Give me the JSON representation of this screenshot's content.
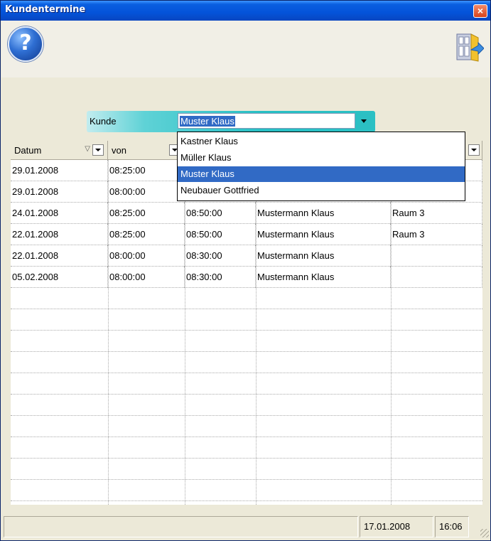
{
  "window": {
    "title": "Kundentermine",
    "close_label": "×"
  },
  "toolbar": {
    "help_label": "?",
    "help_icon": "help-icon",
    "exit_icon": "exit-door-icon"
  },
  "filter": {
    "label": "Kunde",
    "value": "Muster Klaus",
    "options": [
      "Kastner  Klaus",
      "Müller Klaus",
      "Muster Klaus",
      "Neubauer Gottfried"
    ],
    "selected_index": 2
  },
  "grid": {
    "columns": [
      {
        "label": "Datum",
        "sortable": true
      },
      {
        "label": "von",
        "sortable": false
      },
      {
        "label": "",
        "sortable": false
      },
      {
        "label": "",
        "sortable": false
      },
      {
        "label": "",
        "sortable": false
      }
    ],
    "sort_glyph": "▽",
    "rows": [
      [
        "29.01.2008",
        "08:25:00",
        "",
        "",
        ""
      ],
      [
        "29.01.2008",
        "08:00:00",
        "",
        "",
        ""
      ],
      [
        "24.01.2008",
        "08:25:00",
        "08:50:00",
        "Mustermann Klaus",
        "Raum 3"
      ],
      [
        "22.01.2008",
        "08:25:00",
        "08:50:00",
        "Mustermann Klaus",
        "Raum 3"
      ],
      [
        "22.01.2008",
        "08:00:00",
        "08:30:00",
        "Mustermann Klaus",
        ""
      ],
      [
        "05.02.2008",
        "08:00:00",
        "08:30:00",
        "Mustermann Klaus",
        ""
      ]
    ]
  },
  "statusbar": {
    "message": "",
    "date": "17.01.2008",
    "time": "16:06"
  },
  "colors": {
    "titlebar": "#0453d9",
    "filter_accent": "#28bfc4",
    "selection": "#316ac5"
  }
}
